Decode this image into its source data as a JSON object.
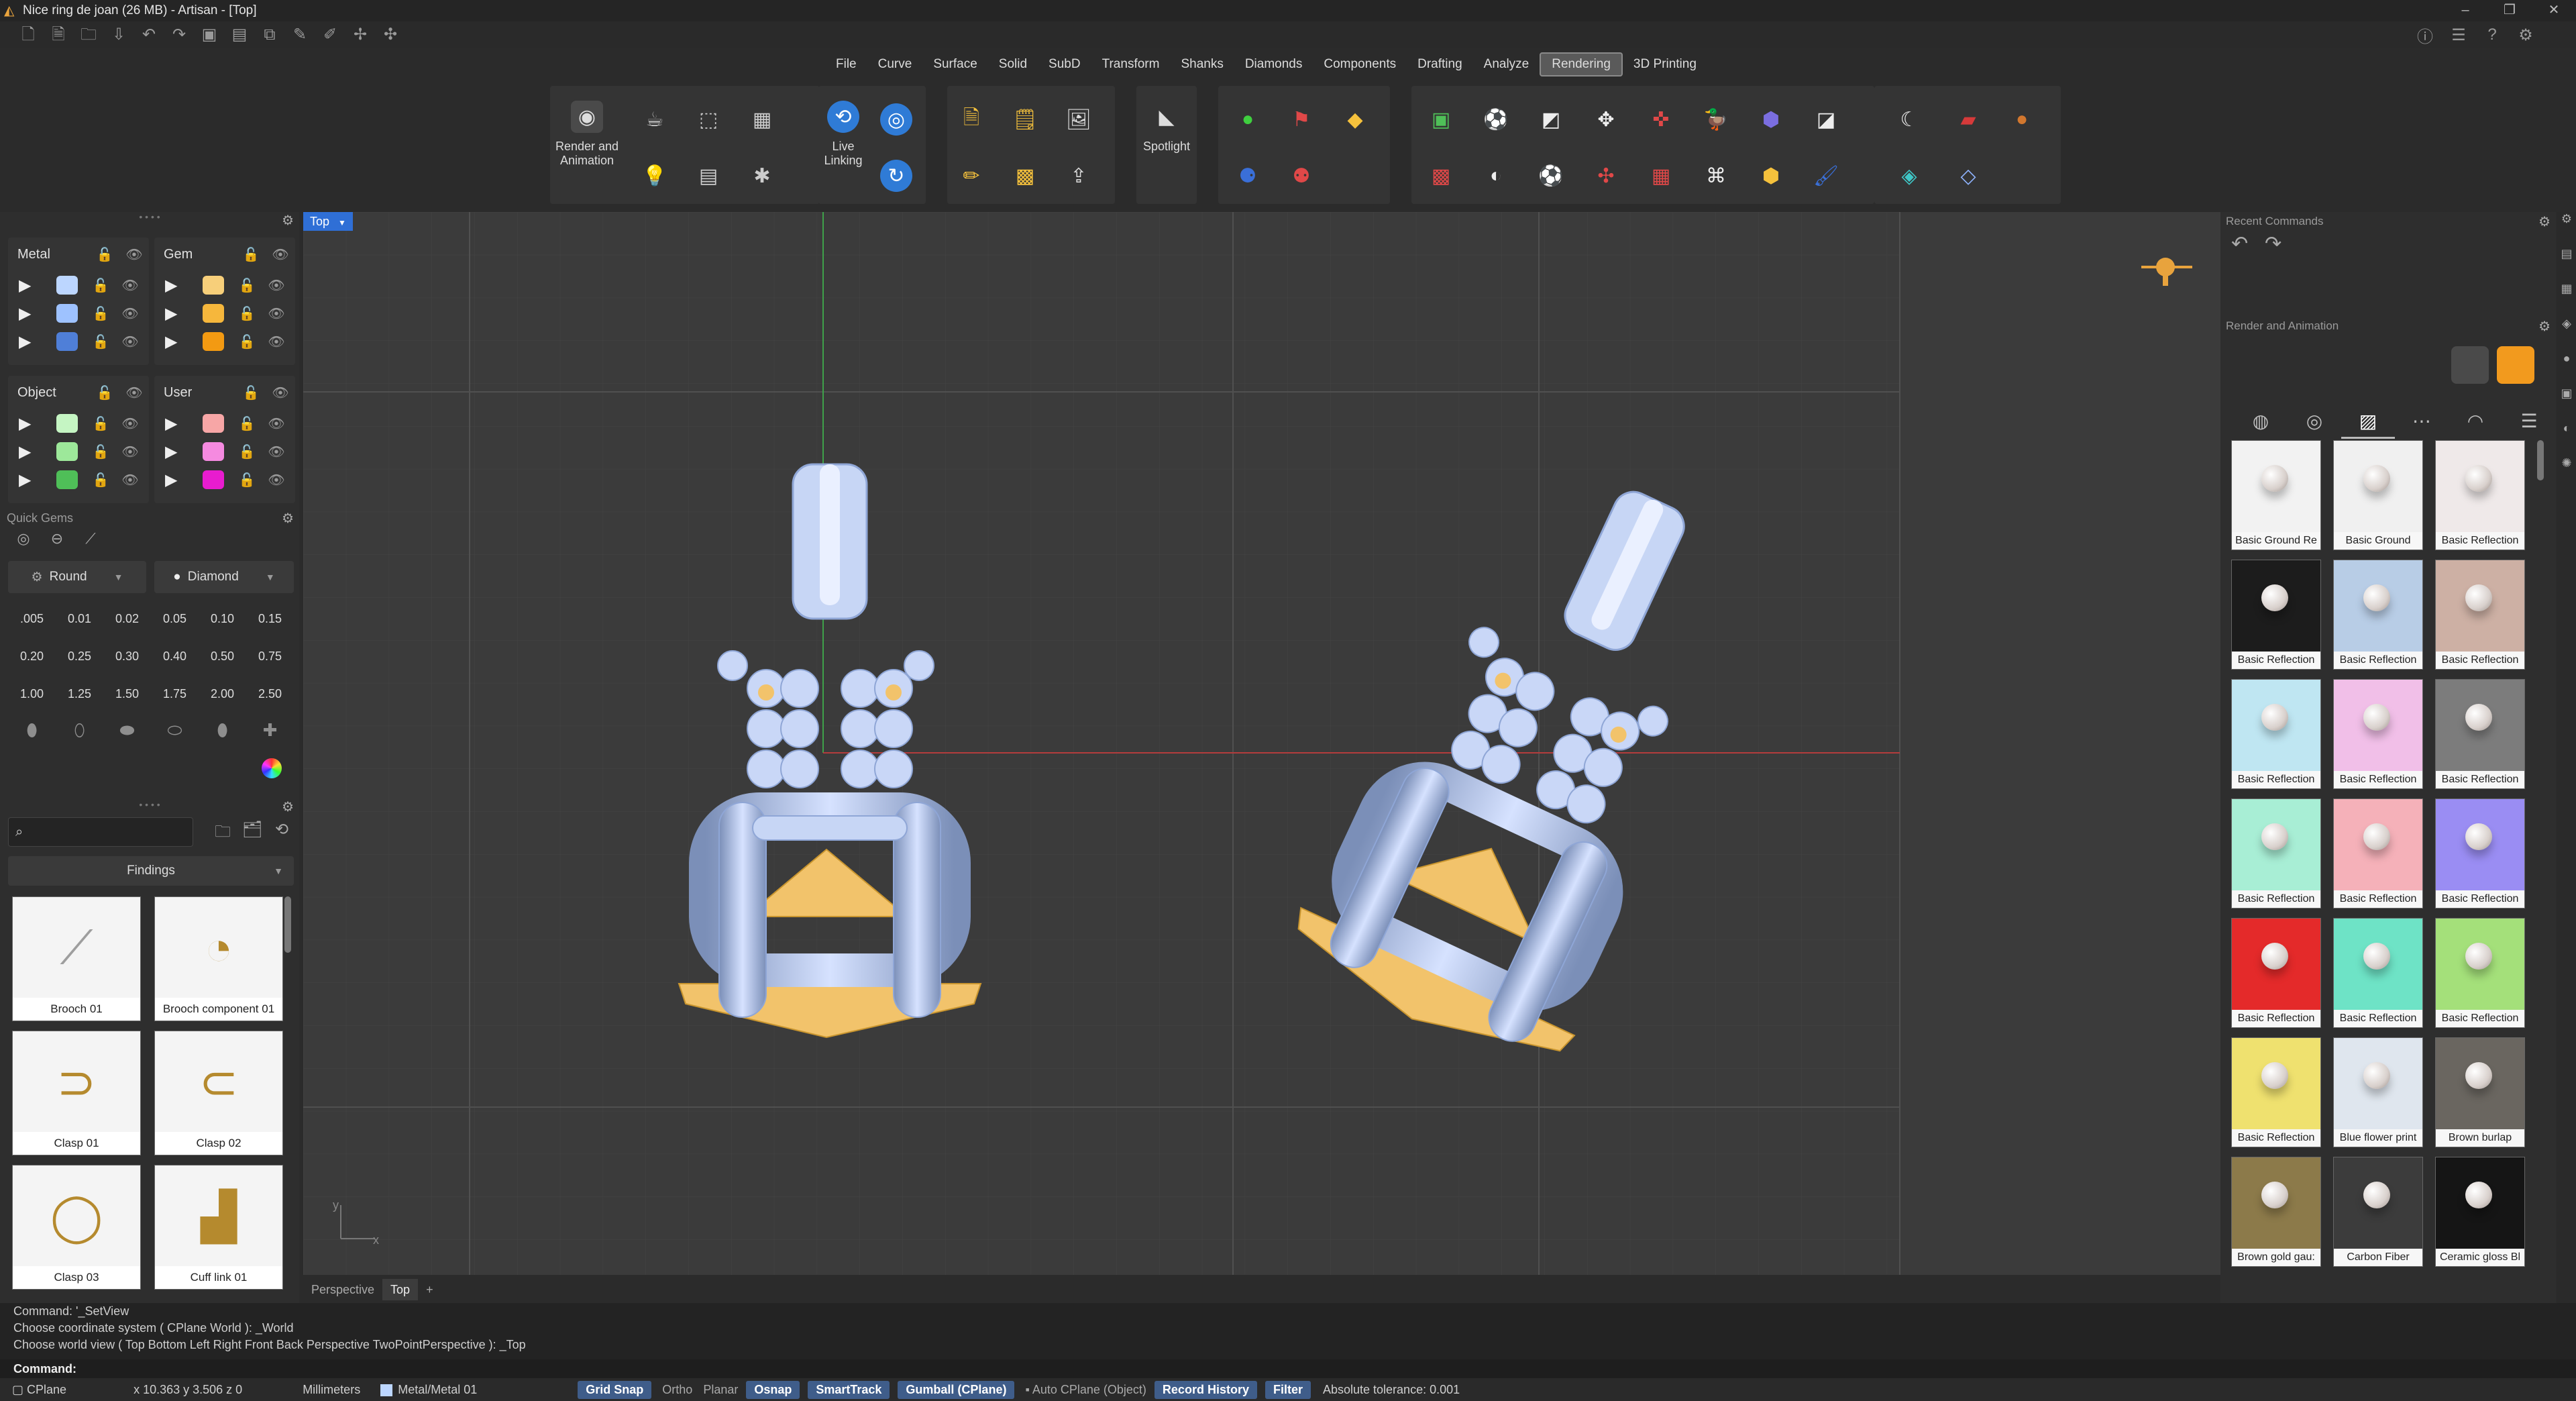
{
  "window": {
    "title": "Nice ring de joan (26 MB) - Artisan - [Top]"
  },
  "menu": [
    "File",
    "Curve",
    "Surface",
    "Solid",
    "SubD",
    "Transform",
    "Shanks",
    "Diamonds",
    "Components",
    "Drafting",
    "Analyze",
    "Rendering",
    "3D Printing"
  ],
  "menu_active": "Rendering",
  "ribbon": {
    "render_label": "Render and Animation",
    "live_label": "Live Linking",
    "spot_label": "Spotlight"
  },
  "layers": {
    "metal": {
      "title": "Metal",
      "colors": [
        "#bcd6ff",
        "#9ec2ff",
        "#4f7fd8"
      ]
    },
    "gem": {
      "title": "Gem",
      "colors": [
        "#f7cf7a",
        "#f6b73c",
        "#f39a12"
      ]
    },
    "object": {
      "title": "Object",
      "colors": [
        "#c5f5c3",
        "#9de89a",
        "#4fbf58"
      ]
    },
    "user": {
      "title": "User",
      "colors": [
        "#f7a6a6",
        "#f58ae0",
        "#e81ccf"
      ]
    }
  },
  "quick_gems": {
    "title": "Quick Gems",
    "shape": "Round",
    "material": "Diamond",
    "sizes": [
      ".005",
      "0.01",
      "0.02",
      "0.05",
      "0.10",
      "0.15",
      "0.20",
      "0.25",
      "0.30",
      "0.40",
      "0.50",
      "0.75",
      "1.00",
      "1.25",
      "1.50",
      "1.75",
      "2.00",
      "2.50"
    ]
  },
  "library": {
    "search_placeholder": "",
    "category": "Findings",
    "items": [
      "Brooch 01",
      "Brooch component 01",
      "Clasp 01",
      "Clasp 02",
      "Clasp 03",
      "Cuff link 01"
    ]
  },
  "viewport": {
    "label": "Top",
    "tabs": [
      "Perspective",
      "Top"
    ],
    "axis_x": "x",
    "axis_y": "y"
  },
  "right_panel": {
    "recent_title": "Recent Commands",
    "render_title": "Render and Animation",
    "materials": [
      {
        "name": "Basic Ground Re",
        "bg": "#f2f2f2"
      },
      {
        "name": "Basic Ground",
        "bg": "#f0f0f0"
      },
      {
        "name": "Basic Reflection",
        "bg": "#efe9e9"
      },
      {
        "name": "Basic Reflection",
        "bg": "#1c1c1c"
      },
      {
        "name": "Basic Reflection",
        "bg": "#b8cde6"
      },
      {
        "name": "Basic Reflection",
        "bg": "#cdb0a4"
      },
      {
        "name": "Basic Reflection",
        "bg": "#bfe6f2"
      },
      {
        "name": "Basic Reflection",
        "bg": "#f1bfe8"
      },
      {
        "name": "Basic Reflection",
        "bg": "#7c7c7c"
      },
      {
        "name": "Basic Reflection",
        "bg": "#a8eed5"
      },
      {
        "name": "Basic Reflection",
        "bg": "#f5b1b9"
      },
      {
        "name": "Basic Reflection",
        "bg": "#9a8df3"
      },
      {
        "name": "Basic Reflection",
        "bg": "#e42a2a"
      },
      {
        "name": "Basic Reflection",
        "bg": "#6ee3c6"
      },
      {
        "name": "Basic Reflection",
        "bg": "#a4e07a"
      },
      {
        "name": "Basic Reflection",
        "bg": "#efe16f"
      },
      {
        "name": "Blue flower print",
        "bg": "#dfe6ee"
      },
      {
        "name": "Brown burlap",
        "bg": "#6a6660"
      },
      {
        "name": "Brown gold gau:",
        "bg": "#8c7a4a"
      },
      {
        "name": "Carbon Fiber",
        "bg": "#3c3c3c"
      },
      {
        "name": "Ceramic gloss Bl",
        "bg": "#151515"
      }
    ]
  },
  "command_history": [
    "Command: '_SetView",
    "Choose coordinate system ( CPlane  World ): _World",
    "Choose world view ( Top  Bottom  Left  Right  Front  Back  Perspective  TwoPointPerspective ): _Top"
  ],
  "command_prompt": "Command:",
  "status": {
    "cplane": "CPlane",
    "coords": "x 10.363  y 3.506  z 0",
    "units": "Millimeters",
    "layer": "Metal/Metal 01",
    "grid_snap": "Grid Snap",
    "ortho": "Ortho",
    "planar": "Planar",
    "osnap": "Osnap",
    "smarttrack": "SmartTrack",
    "gumball": "Gumball (CPlane)",
    "autocplane": "Auto CPlane (Object)",
    "record_history": "Record History",
    "filter": "Filter",
    "tolerance": "Absolute tolerance: 0.001"
  }
}
